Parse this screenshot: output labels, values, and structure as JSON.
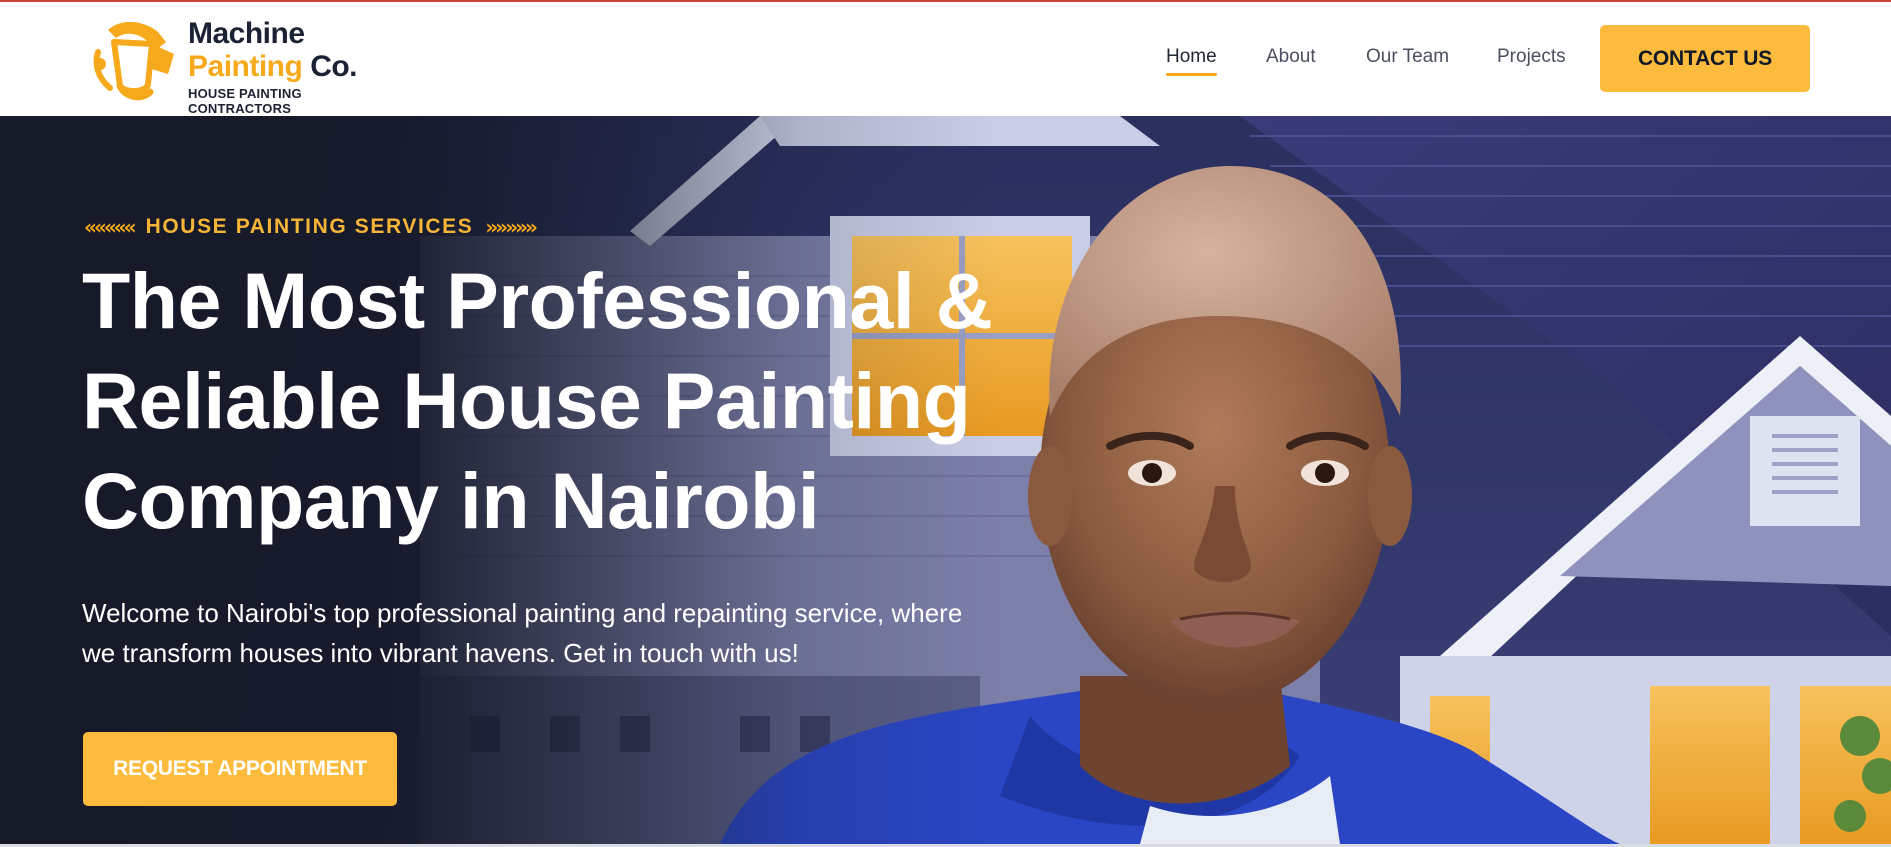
{
  "brand": {
    "name_line1": "Machine",
    "name_line2_accent": "Painting",
    "name_line2_rest": "Co.",
    "tagline": "HOUSE PAINTING CONTRACTORS",
    "accent_color": "#f6a91b",
    "dark_color": "#1b2233"
  },
  "nav": {
    "items": [
      {
        "label": "Home",
        "active": true
      },
      {
        "label": "About",
        "active": false
      },
      {
        "label": "Our Team",
        "active": false
      },
      {
        "label": "Projects",
        "active": false
      }
    ],
    "cta_label": "CONTACT US",
    "cta_color": "#fcbb3c"
  },
  "hero": {
    "kicker": "HOUSE PAINTING SERVICES",
    "kicker_left_icon": "double-chevron-left-icon",
    "kicker_right_icon": "double-chevron-right-icon",
    "title": "The Most Professional & Reliable House Painting Company in Nairobi",
    "subtitle": "Welcome to Nairobi's top professional painting and repainting service, where we transform houses into vibrant havens. Get in touch with us!",
    "button_label": "REQUEST APPOINTMENT",
    "image": "painter-portrait-in-front-of-house"
  }
}
